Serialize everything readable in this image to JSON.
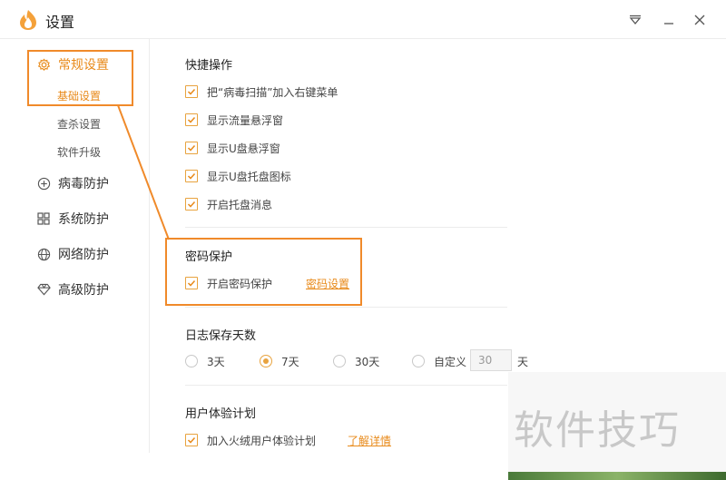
{
  "window": {
    "title": "设置"
  },
  "sidebar": {
    "items": [
      {
        "label": "常规设置",
        "icon": "gear-icon"
      },
      {
        "label": "病毒防护",
        "icon": "plus-circle-icon"
      },
      {
        "label": "系统防护",
        "icon": "grid-icon"
      },
      {
        "label": "网络防护",
        "icon": "globe-icon"
      },
      {
        "label": "高级防护",
        "icon": "diamond-icon"
      }
    ],
    "sub_items": [
      "基础设置",
      "查杀设置",
      "软件升级"
    ]
  },
  "quick_ops": {
    "title": "快捷操作",
    "options": [
      "把“病毒扫描”加入右键菜单",
      "显示流量悬浮窗",
      "显示U盘悬浮窗",
      "显示U盘托盘图标",
      "开启托盘消息"
    ]
  },
  "password": {
    "title": "密码保护",
    "option": "开启密码保护",
    "link": "密码设置"
  },
  "log_days": {
    "title": "日志保存天数",
    "options": [
      "3天",
      "7天",
      "30天",
      "自定义"
    ],
    "selected": "7天",
    "custom_value": "30",
    "unit": "天"
  },
  "ux_plan": {
    "title": "用户体验计划",
    "option": "加入火绒用户体验计划",
    "link": "了解详情"
  },
  "watermark": "软件技巧",
  "colors": {
    "accent": "#e88a1a",
    "highlight": "#f08a2a"
  }
}
